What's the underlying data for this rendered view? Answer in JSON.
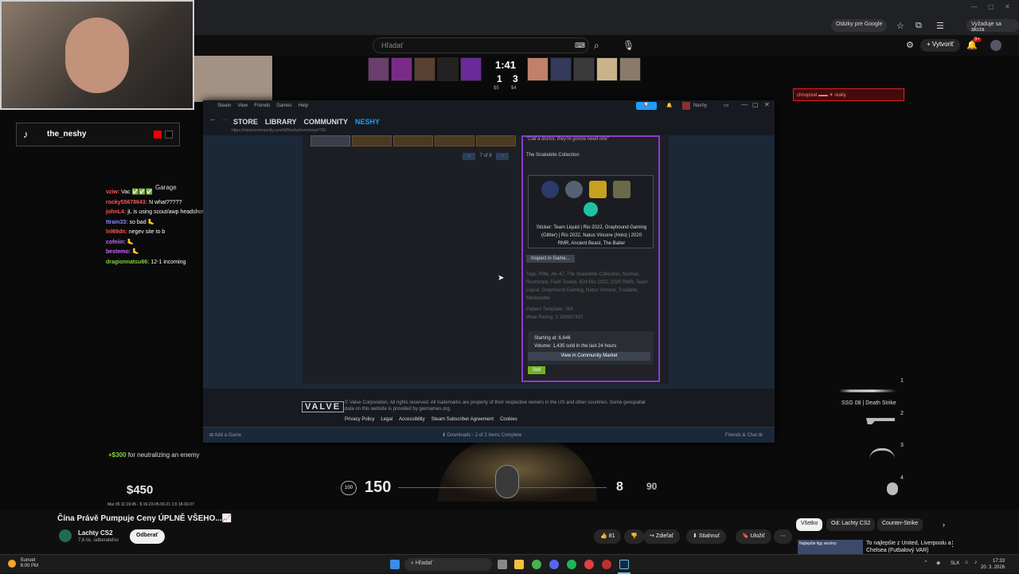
{
  "browser": {
    "google_chip": "Otázky pre Google",
    "share_chip": "Vyžaduje sa akcia"
  },
  "youtube": {
    "search_placeholder": "Hľadať",
    "create_label": "Vytvoriť",
    "notif_count": "9+",
    "video_title": "Čína Právě Pumpuje Ceny ÚPLNĚ VŠEHO...📈",
    "channel_name": "Lachty CS2",
    "channel_subs": "7,6 tis. odberateľov",
    "subscribe_label": "Odberať",
    "likes": "81",
    "share_label": "Zdieľať",
    "download_label": "Stiahnuť",
    "save_label": "Uložiť",
    "chips": [
      "Všetko",
      "Od: Lachty CS2",
      "Counter-Strike"
    ],
    "rec_title": "To najlepšie z United, Liverpoolu a Chelsea (Futbalový VAR)",
    "rec_thumb_text": "Najlepšie ligy sezóny"
  },
  "stream": {
    "tiktok_name": "the_neshy",
    "garage_label": "Garage",
    "chat": [
      {
        "user": "vziw:",
        "msg": " Vac ✅✅✅",
        "color": "#ff5555"
      },
      {
        "user": "rocky55678643:",
        "msg": " N what?????",
        "color": "#ff5555"
      },
      {
        "user": "johnL4:",
        "msg": " jL is using scout/awp headshots only",
        "color": "#ff5555"
      },
      {
        "user": "ttrain33:",
        "msg": " so bad 🦶",
        "color": "#8888ff"
      },
      {
        "user": "lnl69dn:",
        "msg": " negev site to b",
        "color": "#ff5555"
      },
      {
        "user": "cofeiin:",
        "msg": " 🦶",
        "color": "#cc66ff"
      },
      {
        "user": "bestemo:",
        "msg": " 🦶",
        "color": "#cc66ff"
      },
      {
        "user": "dragionnatsu66:",
        "msg": " 12-1 incoming",
        "color": "#7fd43c"
      }
    ],
    "killfeed": "chnopixel ▬▬ ✈ really"
  },
  "scoreboard": {
    "timer": "1:41",
    "score_left": "1",
    "score_right": "3",
    "sub_left": "$5",
    "sub_right": "$4"
  },
  "steam": {
    "menu": [
      "Steam",
      "View",
      "Friends",
      "Games",
      "Help"
    ],
    "nav": [
      "STORE",
      "LIBRARY",
      "COMMUNITY",
      "NESHY"
    ],
    "user": "Neshy",
    "url": "https://steamcommunity.com/id/Neshy/inventory/#730",
    "pager": "7 of 8",
    "item_quote": "\"Call a doctor, they're gonna need one\"",
    "collection": "The Snakebite Collection",
    "sticker_text": "Sticker: Team Liquid | Rio 2022, Grayhound Gaming (Glitter) | Rio 2022, Natus Vincere (Holo) | 2020 RMR, Ancient Beast, The Baiter",
    "inspect_label": "Inspect in Game...",
    "tags": "Tags: Rifle, AK-47, The Snakebite Collection, Normal, Restricted, Field-Tested, IEM Rio 2022, 2020 RMR, Team Liquid, Grayhound Gaming, Natus Vincere, Tradable, Marketable",
    "pattern": "Pattern Template: 764",
    "wear": "Wear Rating: 0.189907432",
    "starting_at": "Starting at: 6,64€",
    "volume": "Volume: 1,435 sold in the last 24 hours",
    "market_btn": "View in Community Market",
    "sell_btn": "Sell",
    "valve": "VALVE",
    "legal": "© Valve Corporation. All rights reserved. All trademarks are property of their respective owners in the US and other countries. Some geospatial data on this website is provided by geonames.org.",
    "footer_links": [
      "Privacy Policy",
      "Legal",
      "Accessibility",
      "Steam Subscriber Agreement",
      "Cookies"
    ],
    "add_game": "Add a Game",
    "downloads": "Downloads - 2 of 2 Items Complete",
    "friends": "Friends & Chat"
  },
  "hud": {
    "money": "$450",
    "bonus_amount": "+$300",
    "bonus_text": " for neutralizing an enemy",
    "timestamp": "Mar 05 11:19:45 - $ 19-23-05-00-21 1:0 18-02-07",
    "armor": "100",
    "hp": "150",
    "ammo": "8",
    "reserve": "90",
    "weapon_name": "SSG 08 | Death Strike",
    "slots": [
      "1",
      "2",
      "3",
      "4"
    ]
  },
  "taskbar": {
    "weather_label": "Sunset",
    "weather_time": "6:00 PM",
    "search_placeholder": "Hľadať",
    "lang": "SLK",
    "time": "17:33",
    "date": "20. 3. 2026"
  }
}
